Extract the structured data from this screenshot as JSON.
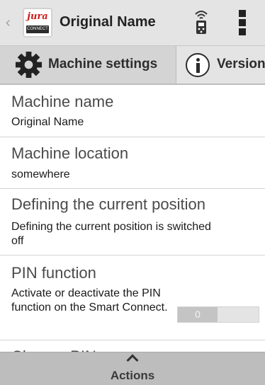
{
  "header": {
    "back_glyph": "‹",
    "logo_brand": "jura",
    "logo_sub": "CONNECT",
    "title": "Original Name",
    "remote_icon": "remote-icon",
    "menu_icon": "more-vertical-icon"
  },
  "tabs": [
    {
      "label": "Machine settings",
      "icon": "gear-icon",
      "active": true
    },
    {
      "label": "Version",
      "icon": "info-icon",
      "active": false
    }
  ],
  "settings": {
    "machine_name": {
      "title": "Machine name",
      "value": "Original Name"
    },
    "machine_location": {
      "title": "Machine location",
      "value": "somewhere"
    },
    "current_position": {
      "title": "Defining the current position",
      "value": "Defining the current position is switched off"
    },
    "pin_function": {
      "title": "PIN function",
      "value": "Activate or deactivate the PIN function on the Smart Connect.",
      "toggle_label": "0",
      "enabled": false
    },
    "change_pin": {
      "title": "Change PIN"
    }
  },
  "actions": {
    "label": "Actions",
    "icon": "chevron-up-icon"
  },
  "colors": {
    "header_bg": "#e4e4e4",
    "active_tab_bg": "#d4d4d4",
    "actions_bg": "#bdbdbd",
    "brand_red": "#d01a1a"
  }
}
